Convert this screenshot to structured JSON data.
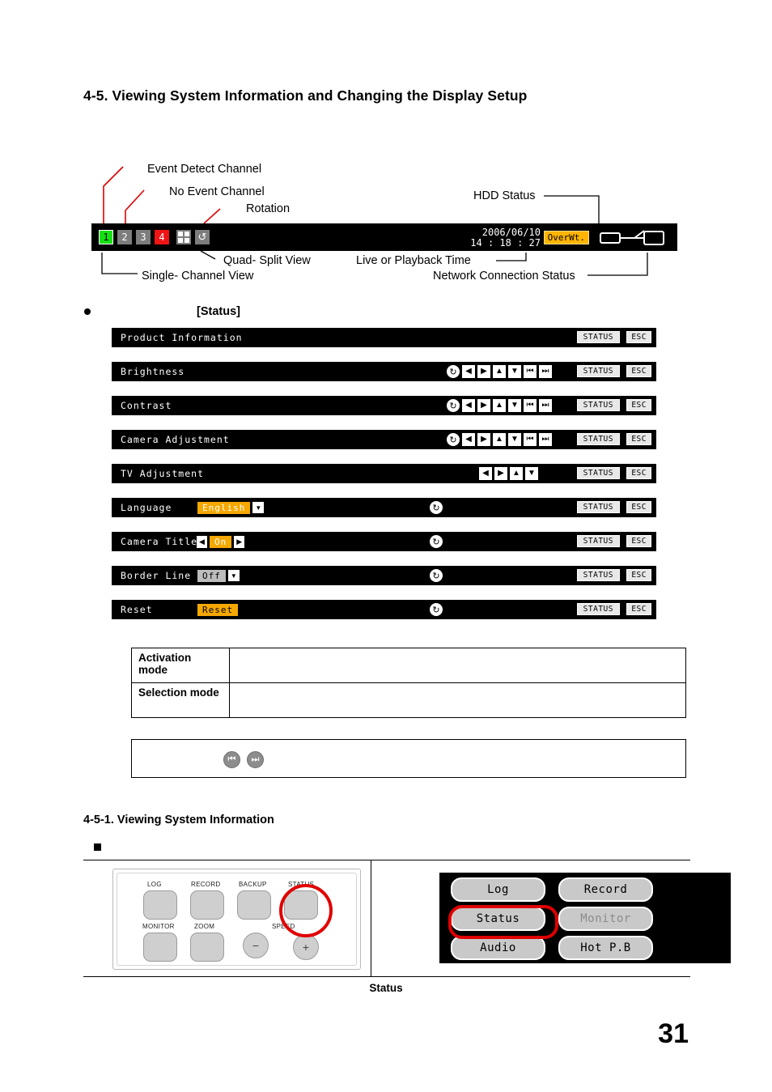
{
  "section": {
    "title": "4-5. Viewing System Information and Changing the Display Setup",
    "subsection_title": "4-5-1. Viewing System Information",
    "bullet_label": "[Status]"
  },
  "callouts": {
    "event_detect_channel": "Event Detect Channel",
    "no_event_channel": "No Event Channel",
    "rotation": "Rotation",
    "hdd_status": "HDD Status",
    "quad_split_view": "Quad- Split View",
    "live_or_playback_time": "Live or Playback Time",
    "single_channel_view": "Single- Channel View",
    "network_connection_status": "Network Connection Status"
  },
  "statusbar": {
    "channels": [
      {
        "label": "1",
        "state": "active"
      },
      {
        "label": "2",
        "state": "gray"
      },
      {
        "label": "3",
        "state": "gray"
      },
      {
        "label": "4",
        "state": "red"
      }
    ],
    "quad_icon": "quad-split-icon",
    "rotation_icon": "rotation-icon",
    "date": "2006/06/10",
    "time": "14 : 18 : 27",
    "hdd_badge": "OverWt.",
    "network_icon": "network-connection-icon"
  },
  "menu": {
    "status_button": "STATUS",
    "esc_button": "ESC",
    "rows": [
      {
        "label": "Product Information",
        "icons": [],
        "value": null
      },
      {
        "label": "Brightness",
        "icons": [
          "reload",
          "left",
          "right",
          "up",
          "down",
          "prev",
          "next"
        ],
        "value": null
      },
      {
        "label": "Contrast",
        "icons": [
          "reload",
          "left",
          "right",
          "up",
          "down",
          "prev",
          "next"
        ],
        "value": null
      },
      {
        "label": "Camera Adjustment",
        "icons": [
          "reload",
          "left",
          "right",
          "up",
          "down",
          "prev",
          "next"
        ],
        "value": null
      },
      {
        "label": "TV Adjustment",
        "icons": [
          "left",
          "right",
          "up",
          "down"
        ],
        "value": null
      },
      {
        "label": "Language",
        "icons": [
          "reload"
        ],
        "value": "English",
        "value_style": "orange-dropdown"
      },
      {
        "label": "Camera Title",
        "icons": [
          "reload"
        ],
        "value": "On",
        "value_style": "blue-arrows"
      },
      {
        "label": "Border Line",
        "icons": [
          "reload"
        ],
        "value": "Off",
        "value_style": "gray-dropdown"
      },
      {
        "label": "Reset",
        "icons": [
          "reload"
        ],
        "value": "Reset",
        "value_style": "orange-button"
      }
    ]
  },
  "table_modes": {
    "rows": [
      {
        "mode": "Activation mode",
        "description": ""
      },
      {
        "mode": "Selection mode",
        "description": ""
      }
    ]
  },
  "table_icons": {
    "icons": [
      "prev-page-icon",
      "next-page-icon"
    ],
    "description": ""
  },
  "front_panel": {
    "buttons_top": [
      "LOG",
      "RECORD",
      "BACKUP",
      "STATUS"
    ],
    "buttons_bottom": [
      "MONITOR",
      "ZOOM"
    ],
    "speed_label": "SPEED",
    "minus": "−",
    "plus": "+",
    "highlight": "status-button-highlight"
  },
  "osd_menu": {
    "buttons": [
      {
        "label": "Log",
        "dim": false
      },
      {
        "label": "Record",
        "dim": false
      },
      {
        "label": "Status",
        "dim": false,
        "highlighted": true
      },
      {
        "label": "Monitor",
        "dim": true
      },
      {
        "label": "Audio",
        "dim": false
      },
      {
        "label": "Hot P.B",
        "dim": false
      }
    ]
  },
  "figure_caption": "Status",
  "page_number": "31",
  "colors": {
    "accent_orange": "#f5a800",
    "highlight_red": "#e00000",
    "channel_active_green": "#14e014",
    "channel_event_red": "#f01414"
  }
}
